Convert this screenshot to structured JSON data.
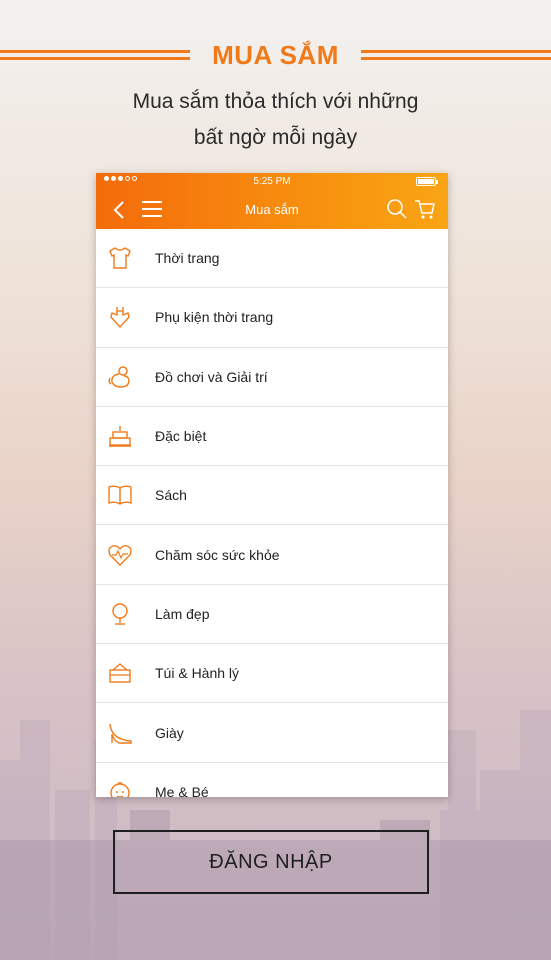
{
  "header": {
    "title": "MUA SẮM",
    "subtitle_line1": "Mua sắm thỏa thích với những",
    "subtitle_line2": "bất ngờ mỗi ngày"
  },
  "phone": {
    "status_time": "5:25 PM",
    "screen_title": "Mua sắm",
    "accent_color": "#f7900f",
    "categories": [
      {
        "label": "Thời trang",
        "icon": "shirt-icon"
      },
      {
        "label": "Phụ kiện thời trang",
        "icon": "accessory-icon"
      },
      {
        "label": "Đồ chơi và Giải trí",
        "icon": "duck-toy-icon"
      },
      {
        "label": "Đặc biệt",
        "icon": "cake-icon"
      },
      {
        "label": "Sách",
        "icon": "book-icon"
      },
      {
        "label": "Chăm sóc sức khỏe",
        "icon": "heart-pulse-icon"
      },
      {
        "label": "Làm đẹp",
        "icon": "mirror-icon"
      },
      {
        "label": "Túi & Hành lý",
        "icon": "bag-icon"
      },
      {
        "label": "Giày",
        "icon": "high-heel-icon"
      },
      {
        "label": "Mẹ & Bé",
        "icon": "baby-icon"
      }
    ]
  },
  "login": {
    "label": "ĐĂNG NHẬP"
  }
}
